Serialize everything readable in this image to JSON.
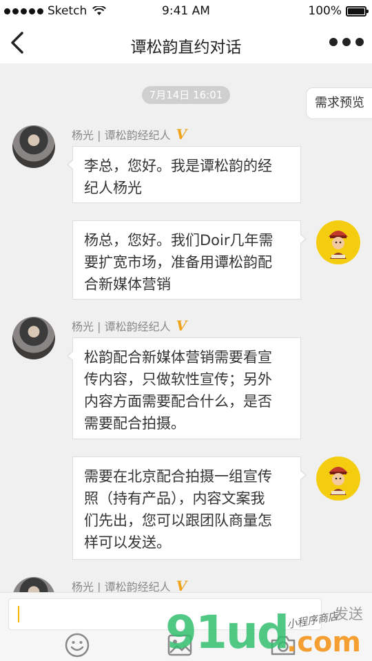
{
  "status_bar": {
    "carrier": "Sketch",
    "time": "9:41 AM",
    "battery": "100%",
    "battery_level": 1.0
  },
  "nav": {
    "title": "谭松韵直约对话"
  },
  "chat": {
    "timestamp": "7月14日  16:01",
    "demand_preview": "需求预览",
    "messages": [
      {
        "side": "left",
        "sender": "杨光 | 谭松韵经纪人",
        "verified": "V",
        "lines": [
          "李总，您好。我是谭松韵的经",
          "纪人杨光"
        ]
      },
      {
        "side": "right",
        "lines": [
          "杨总，您好。我们Doir几年需",
          "要扩宽市场，准备用谭松韵配",
          "合新媒体营销"
        ]
      },
      {
        "side": "left",
        "sender": "杨光 | 谭松韵经纪人",
        "verified": "V",
        "lines": [
          "松韵配合新媒体营销需要看宣",
          "传内容，只做软性宣传；另外",
          "内容方面需要配合什么，是否",
          "需要配合拍摄。"
        ]
      },
      {
        "side": "right",
        "lines": [
          "需要在北京配合拍摄一组宣传",
          "照（持有产品），内容文案我",
          "们先出，您可以跟团队商量怎",
          "样可以发送。"
        ]
      },
      {
        "side": "left",
        "sender": "杨光 | 谭松韵经纪人",
        "verified": "V",
        "lines": []
      }
    ]
  },
  "input": {
    "value": "",
    "send_label": "发送"
  },
  "toolbar": {
    "icons": [
      "emoji-icon",
      "image-icon",
      "camera-icon"
    ]
  },
  "watermark": {
    "main": "91ud",
    "domain": ".com",
    "sub": "小程序商店"
  },
  "colors": {
    "accent": "#f5b800",
    "verified": "#f0a218",
    "background": "#f0f0f0",
    "watermark_green": "#32be6e",
    "watermark_orange": "#f5961e"
  }
}
